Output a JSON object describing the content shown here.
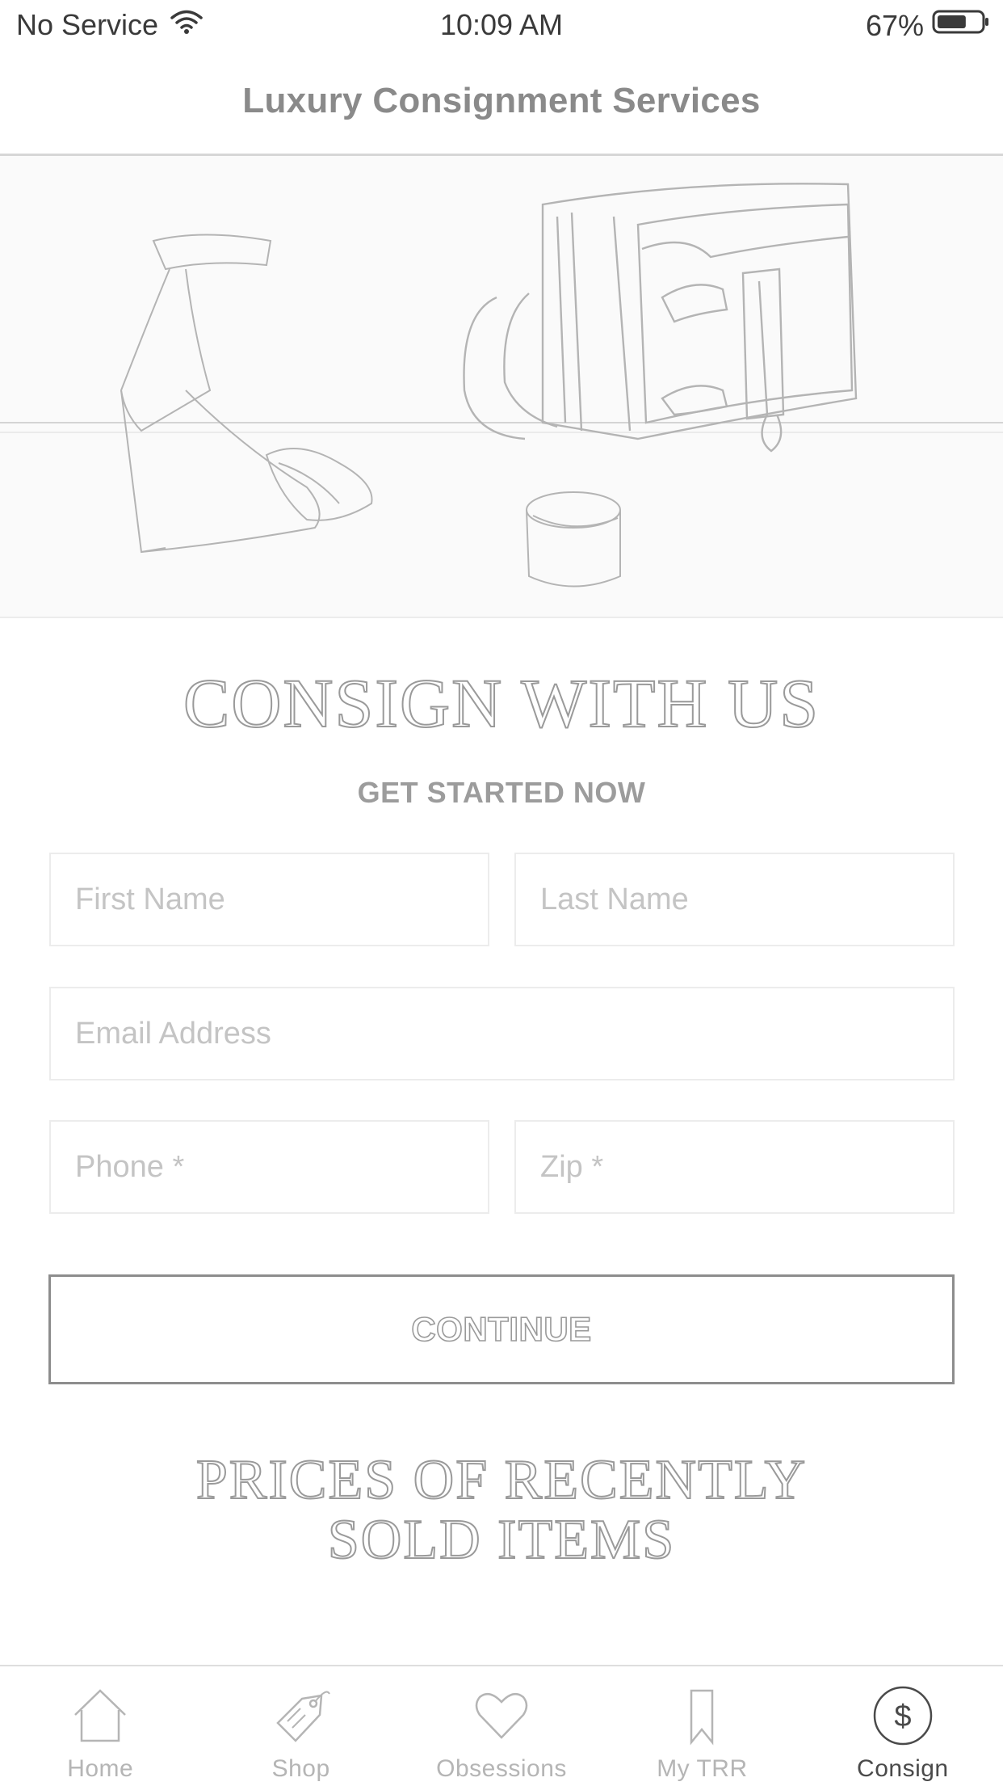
{
  "status_bar": {
    "carrier": "No Service",
    "time": "10:09 AM",
    "battery_percent": "67%",
    "battery_level": 0.67
  },
  "header": {
    "title": "Luxury Consignment Services"
  },
  "hero": {
    "image_icon": "hero-products-illustration"
  },
  "consign": {
    "title": "CONSIGN WITH US",
    "subtitle": "GET STARTED NOW"
  },
  "form": {
    "first_name": {
      "value": "",
      "placeholder": "First Name"
    },
    "last_name": {
      "value": "",
      "placeholder": "Last Name"
    },
    "email": {
      "value": "",
      "placeholder": "Email Address"
    },
    "phone": {
      "value": "",
      "placeholder": "Phone *"
    },
    "zip": {
      "value": "",
      "placeholder": "Zip *"
    },
    "continue_label": "CONTINUE"
  },
  "prices": {
    "title_line1": "PRICES OF RECENTLY",
    "title_line2": "SOLD ITEMS"
  },
  "tab_bar": {
    "items": [
      {
        "label": "Home",
        "icon": "home-icon",
        "active": false
      },
      {
        "label": "Shop",
        "icon": "tag-icon",
        "active": false
      },
      {
        "label": "Obsessions",
        "icon": "heart-icon",
        "active": false
      },
      {
        "label": "My TRR",
        "icon": "bookmark-icon",
        "active": false
      },
      {
        "label": "Consign",
        "icon": "dollar-circle-icon",
        "active": true
      }
    ]
  },
  "colors": {
    "text_dark": "#4a4a4a",
    "text_muted": "#b5b5b5",
    "border": "#ececec",
    "button_border": "#8d8d8d"
  }
}
